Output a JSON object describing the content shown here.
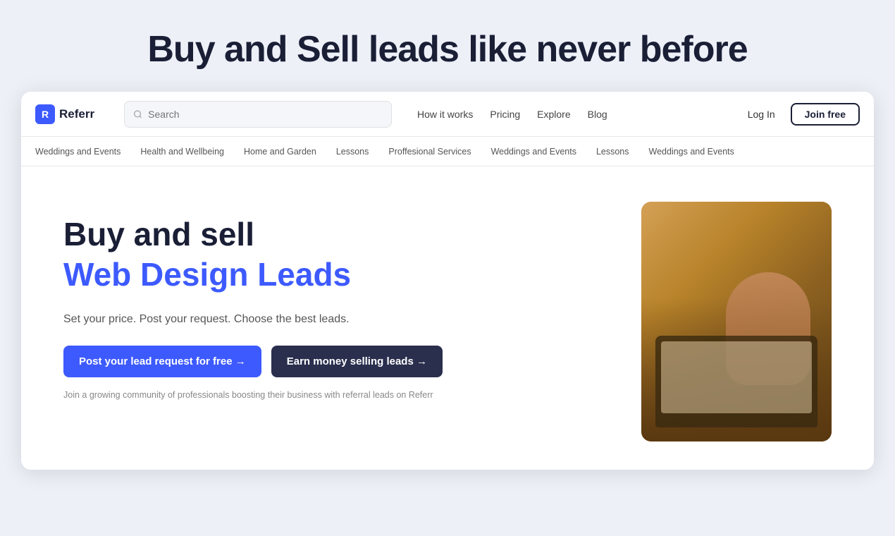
{
  "page": {
    "outer_heading": "Buy and Sell leads like never before"
  },
  "navbar": {
    "logo_text": "Referr",
    "search_placeholder": "Search",
    "links": [
      {
        "label": "How it works",
        "key": "how-it-works"
      },
      {
        "label": "Pricing",
        "key": "pricing"
      },
      {
        "label": "Explore",
        "key": "explore"
      },
      {
        "label": "Blog",
        "key": "blog"
      }
    ],
    "login_label": "Log In",
    "join_label": "Join free"
  },
  "categories": [
    "Weddings and Events",
    "Health and Wellbeing",
    "Home and Garden",
    "Lessons",
    "Proffesional Services",
    "Weddings and Events",
    "Lessons",
    "Weddings and Events"
  ],
  "hero": {
    "title_plain": "Buy and sell",
    "title_blue": "Web Design Leads",
    "subtitle": "Set your price. Post your request. Choose the best leads.",
    "btn_primary": "Post your lead request for free  →",
    "btn_secondary": "Earn money selling leads  →",
    "community_text": "Join a growing community of professionals boosting their business with referral leads on Referr"
  }
}
